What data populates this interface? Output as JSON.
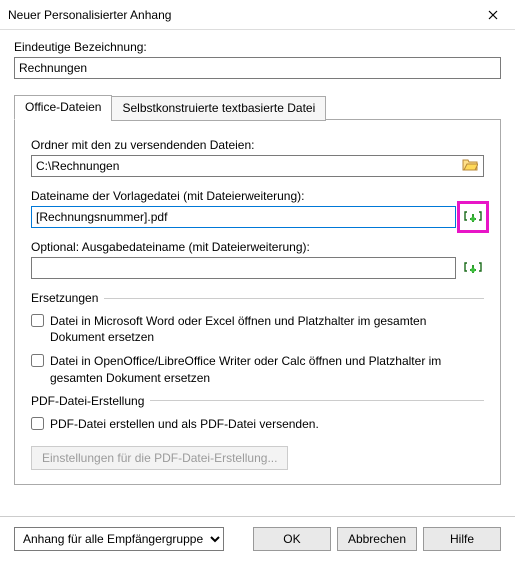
{
  "title": "Neuer Personalisierter Anhang",
  "uniqueId": {
    "label": "Eindeutige Bezeichnung:",
    "value": "Rechnungen"
  },
  "tabs": {
    "office": "Office-Dateien",
    "selfConstructed": "Selbstkonstruierte textbasierte Datei"
  },
  "officePanel": {
    "folderLabel": "Ordner mit den zu versendenden Dateien:",
    "folderValue": "C:\\Rechnungen",
    "templateLabel": "Dateiname der Vorlagedatei (mit Dateierweiterung):",
    "templateValue": "[Rechnungsnummer].pdf",
    "outputLabel": "Optional: Ausgabedateiname (mit Dateierweiterung):",
    "outputValue": "",
    "replacementsHeader": "Ersetzungen",
    "cbWord": "Datei in Microsoft Word oder Excel öffnen und Platzhalter im gesamten Dokument ersetzen",
    "cbOpenOffice": "Datei in OpenOffice/LibreOffice Writer oder Calc öffnen und Platzhalter im gesamten Dokument ersetzen",
    "pdfHeader": "PDF-Datei-Erstellung",
    "cbPdf": "PDF-Datei erstellen und als PDF-Datei versenden.",
    "pdfSettingsBtn": "Einstellungen für die PDF-Datei-Erstellung..."
  },
  "footer": {
    "scopeSelected": "Anhang für alle Empfängergruppen",
    "ok": "OK",
    "cancel": "Abbrechen",
    "help": "Hilfe"
  }
}
